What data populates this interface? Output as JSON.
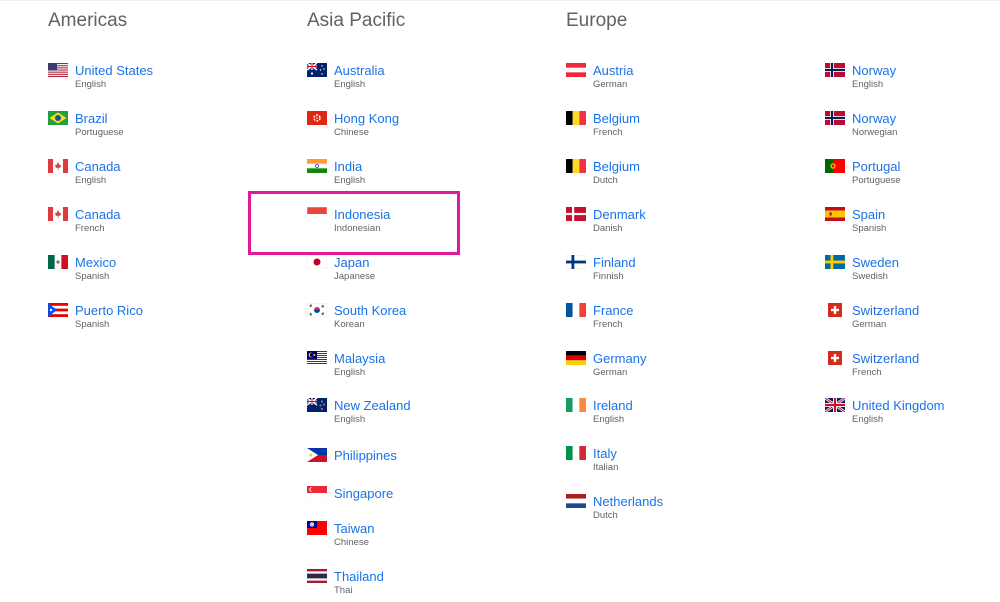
{
  "regions": [
    {
      "id": "americas",
      "title": "Americas",
      "items": [
        {
          "country": "United States",
          "language": "English",
          "flag": "us-flag-icon"
        },
        {
          "country": "Brazil",
          "language": "Portuguese",
          "flag": "br-flag-icon"
        },
        {
          "country": "Canada",
          "language": "English",
          "flag": "ca-flag-icon"
        },
        {
          "country": "Canada",
          "language": "French",
          "flag": "ca-flag-icon"
        },
        {
          "country": "Mexico",
          "language": "Spanish",
          "flag": "mx-flag-icon"
        },
        {
          "country": "Puerto Rico",
          "language": "Spanish",
          "flag": "pr-flag-icon"
        }
      ]
    },
    {
      "id": "asia-pacific",
      "title": "Asia Pacific",
      "items": [
        {
          "country": "Australia",
          "language": "English",
          "flag": "au-flag-icon"
        },
        {
          "country": "Hong Kong",
          "language": "Chinese",
          "flag": "hk-flag-icon"
        },
        {
          "country": "India",
          "language": "English",
          "flag": "in-flag-icon"
        },
        {
          "country": "Indonesia",
          "language": "Indonesian",
          "flag": "id-flag-icon"
        },
        {
          "country": "Japan",
          "language": "Japanese",
          "flag": "jp-flag-icon"
        },
        {
          "country": "South Korea",
          "language": "Korean",
          "flag": "kr-flag-icon"
        },
        {
          "country": "Malaysia",
          "language": "English",
          "flag": "my-flag-icon"
        },
        {
          "country": "New Zealand",
          "language": "English",
          "flag": "nz-flag-icon"
        },
        {
          "country": "Philippines",
          "language": "",
          "flag": "ph-flag-icon"
        },
        {
          "country": "Singapore",
          "language": "",
          "flag": "sg-flag-icon"
        },
        {
          "country": "Taiwan",
          "language": "Chinese",
          "flag": "tw-flag-icon"
        },
        {
          "country": "Thailand",
          "language": "Thai",
          "flag": "th-flag-icon"
        }
      ]
    },
    {
      "id": "europe",
      "title": "Europe",
      "items": [
        {
          "country": "Austria",
          "language": "German",
          "flag": "at-flag-icon"
        },
        {
          "country": "Belgium",
          "language": "French",
          "flag": "be-flag-icon"
        },
        {
          "country": "Belgium",
          "language": "Dutch",
          "flag": "be-flag-icon"
        },
        {
          "country": "Denmark",
          "language": "Danish",
          "flag": "dk-flag-icon"
        },
        {
          "country": "Finland",
          "language": "Finnish",
          "flag": "fi-flag-icon"
        },
        {
          "country": "France",
          "language": "French",
          "flag": "fr-flag-icon"
        },
        {
          "country": "Germany",
          "language": "German",
          "flag": "de-flag-icon"
        },
        {
          "country": "Ireland",
          "language": "English",
          "flag": "ie-flag-icon"
        },
        {
          "country": "Italy",
          "language": "Italian",
          "flag": "it-flag-icon"
        },
        {
          "country": "Netherlands",
          "language": "Dutch",
          "flag": "nl-flag-icon"
        }
      ]
    },
    {
      "id": "europe-continued",
      "title": "",
      "items": [
        {
          "country": "Norway",
          "language": "English",
          "flag": "no-flag-icon"
        },
        {
          "country": "Norway",
          "language": "Norwegian",
          "flag": "no-flag-icon"
        },
        {
          "country": "Portugal",
          "language": "Portuguese",
          "flag": "pt-flag-icon"
        },
        {
          "country": "Spain",
          "language": "Spanish",
          "flag": "es-flag-icon"
        },
        {
          "country": "Sweden",
          "language": "Swedish",
          "flag": "se-flag-icon"
        },
        {
          "country": "Switzerland",
          "language": "German",
          "flag": "ch-flag-icon"
        },
        {
          "country": "Switzerland",
          "language": "French",
          "flag": "ch-flag-icon"
        },
        {
          "country": "United Kingdom",
          "language": "English",
          "flag": "gb-flag-icon"
        }
      ]
    }
  ],
  "colors": {
    "link": "#1a73e8",
    "heading": "#5f6368",
    "subtext": "#5f6368",
    "highlight": "#e11a9a"
  },
  "highlighted": "Indonesia"
}
